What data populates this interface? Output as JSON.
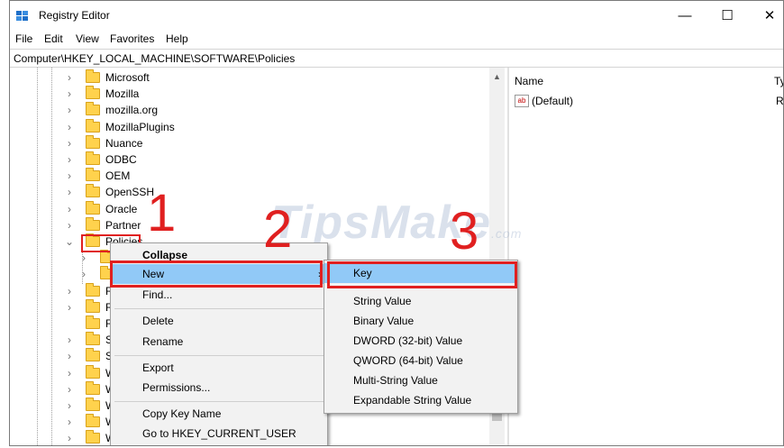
{
  "window": {
    "title": "Registry Editor",
    "minimize": "—",
    "maximize": "☐",
    "close": "✕"
  },
  "menu": [
    "File",
    "Edit",
    "View",
    "Favorites",
    "Help"
  ],
  "address": "Computer\\HKEY_LOCAL_MACHINE\\SOFTWARE\\Policies",
  "tree": {
    "items": [
      {
        "label": "Microsoft",
        "expand": "›"
      },
      {
        "label": "Mozilla",
        "expand": "›"
      },
      {
        "label": "mozilla.org",
        "expand": "›"
      },
      {
        "label": "MozillaPlugins",
        "expand": "›"
      },
      {
        "label": "Nuance",
        "expand": "›"
      },
      {
        "label": "ODBC",
        "expand": "›"
      },
      {
        "label": "OEM",
        "expand": "›"
      },
      {
        "label": "OpenSSH",
        "expand": "›"
      },
      {
        "label": "Oracle",
        "expand": "›"
      },
      {
        "label": "Partner",
        "expand": "›"
      },
      {
        "label": "Policies",
        "expand": "⌄"
      },
      {
        "label": "",
        "expand": "›"
      },
      {
        "label": "",
        "expand": "›"
      },
      {
        "label": "R-c",
        "expand": "›"
      },
      {
        "label": "Rea",
        "expand": "›"
      },
      {
        "label": "Reg",
        "expand": ""
      },
      {
        "label": "SRS",
        "expand": "›"
      },
      {
        "label": "Syn",
        "expand": "›"
      },
      {
        "label": "Wa",
        "expand": "›"
      },
      {
        "label": "We",
        "expand": "›"
      },
      {
        "label": "Win",
        "expand": "›"
      },
      {
        "label": "Win",
        "expand": "›"
      },
      {
        "label": "WC",
        "expand": "›"
      }
    ]
  },
  "list": {
    "columns": [
      "Name",
      "Ty"
    ],
    "values": [
      {
        "name": "(Default)",
        "type": "RE",
        "icon": "ab"
      }
    ]
  },
  "context_menu": {
    "items": [
      "Collapse",
      "New",
      "Find...",
      "Delete",
      "Rename",
      "Export",
      "Permissions...",
      "Copy Key Name",
      "Go to HKEY_CURRENT_USER"
    ],
    "submenu_arrow": "›"
  },
  "submenu": {
    "items": [
      "Key",
      "String Value",
      "Binary Value",
      "DWORD (32-bit) Value",
      "QWORD (64-bit) Value",
      "Multi-String Value",
      "Expandable String Value"
    ]
  },
  "annotations": {
    "step1": "1",
    "step2": "2",
    "step3": "3"
  },
  "watermark": {
    "text": "TipsMake",
    "suffix": ".com"
  },
  "colors": {
    "highlight": "#91c9f7",
    "annotation": "#e02020",
    "folder": "#ffd24d"
  }
}
